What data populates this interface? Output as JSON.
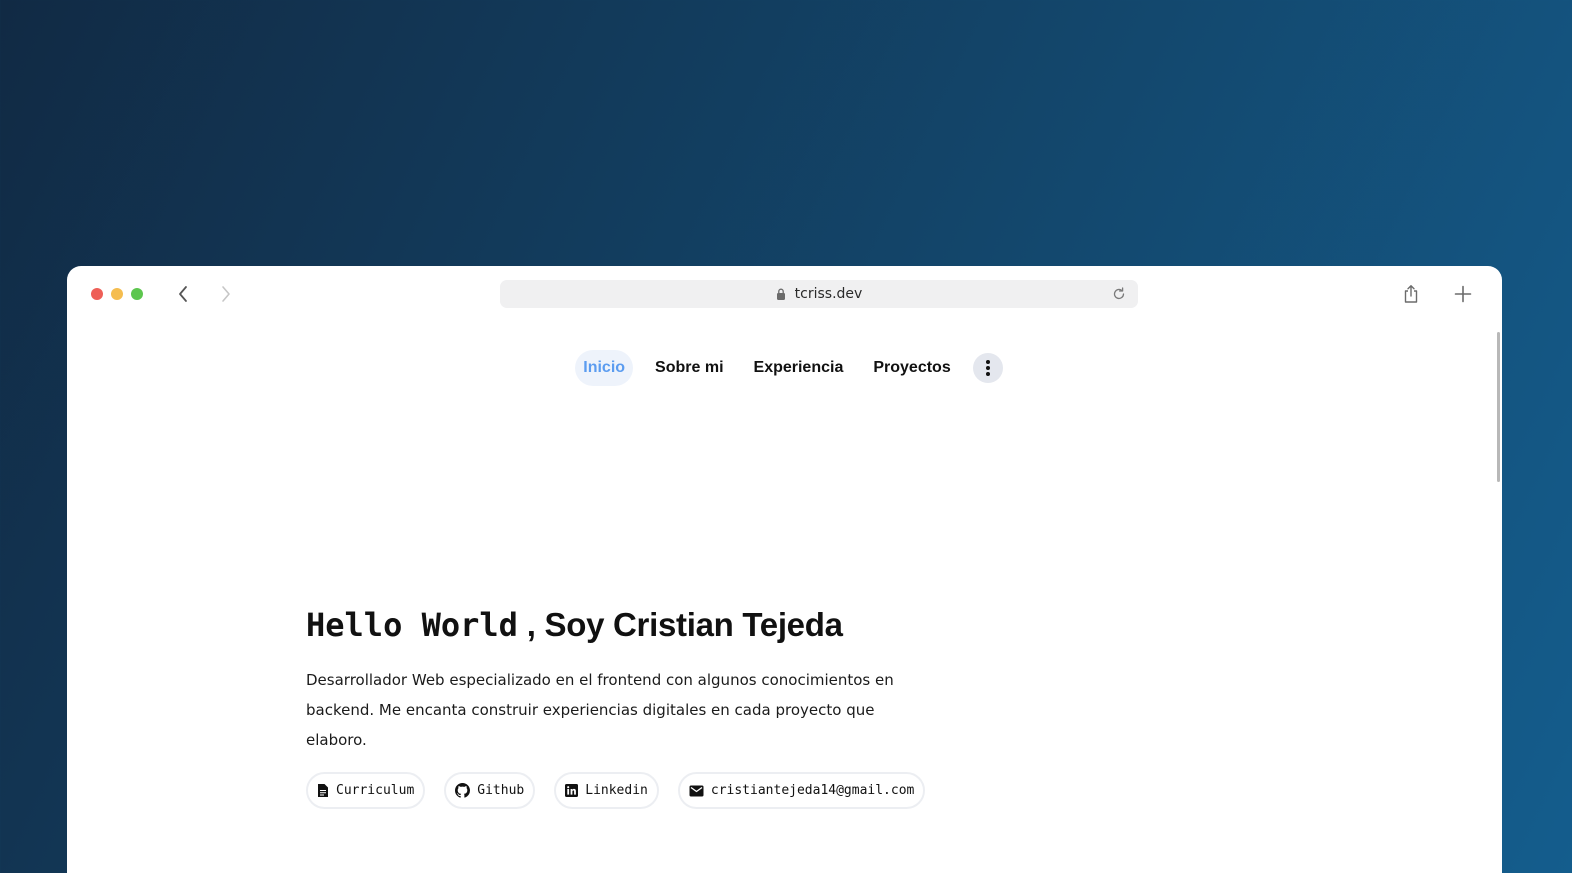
{
  "browser": {
    "url": "tcriss.dev"
  },
  "nav": {
    "items": [
      {
        "label": "Inicio"
      },
      {
        "label": "Sobre mi"
      },
      {
        "label": "Experiencia"
      },
      {
        "label": "Proyectos"
      }
    ],
    "more_icon": "vertical-dots-icon"
  },
  "hero": {
    "greeting": "Hello World",
    "title_rest": ", Soy Cristian Tejeda",
    "description": "Desarrollador Web especializado en el frontend con algunos conocimientos en backend. Me encanta construir experiencias digitales en cada proyecto que elaboro.",
    "links": [
      {
        "label": "Curriculum",
        "icon": "document-icon"
      },
      {
        "label": "Github",
        "icon": "github-icon"
      },
      {
        "label": "Linkedin",
        "icon": "linkedin-icon"
      },
      {
        "label": "cristiantejeda14@gmail.com",
        "icon": "mail-icon"
      }
    ]
  },
  "colors": {
    "accent": "#5b9cf0",
    "background_top": "#112a44",
    "background_bottom": "#145d8d"
  }
}
